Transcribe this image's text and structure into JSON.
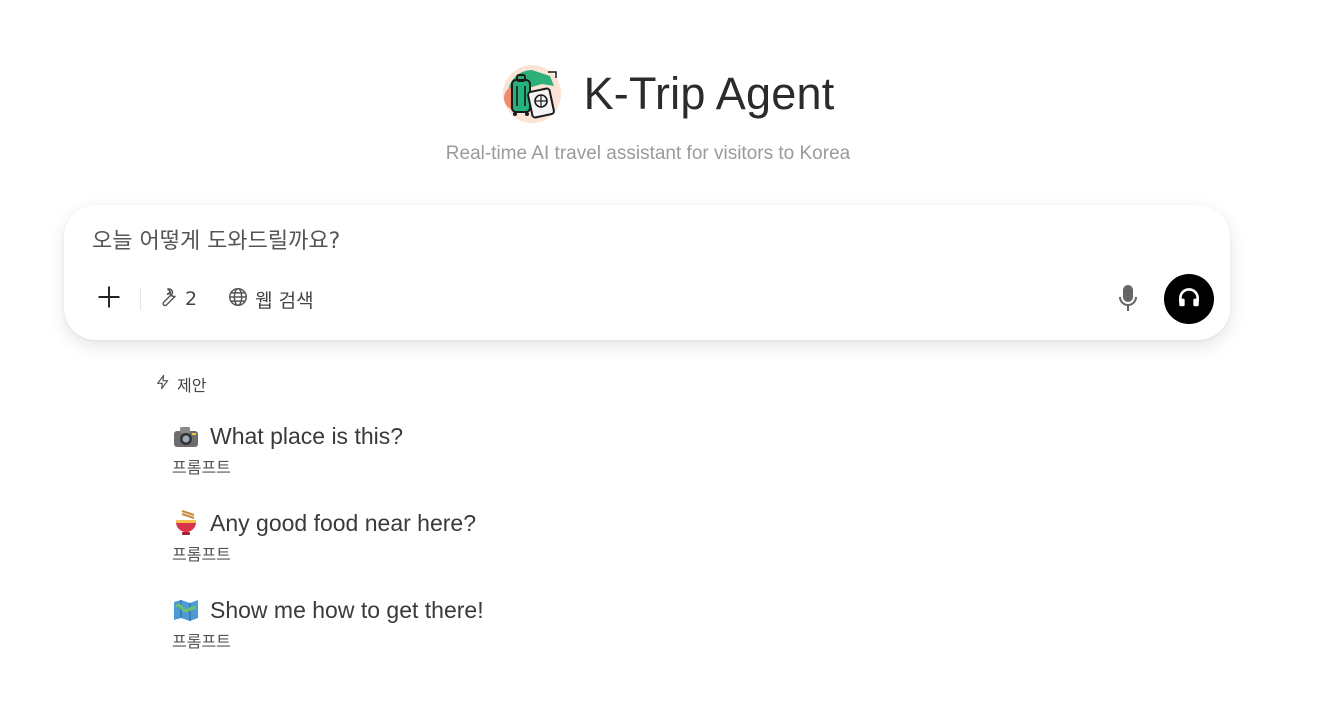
{
  "header": {
    "title": "K-Trip Agent",
    "subtitle": "Real-time AI travel assistant for visitors to Korea",
    "logo_icon": "suitcase-passport-icon"
  },
  "chat": {
    "placeholder": "오늘 어떻게 도와드릴까요?",
    "value": "",
    "toolbar": {
      "add_icon": "plus-icon",
      "tools_icon": "wrench-icon",
      "tools_count": "2",
      "web_search_icon": "globe-icon",
      "web_search_label": "웹 검색",
      "mic_icon": "microphone-icon",
      "voice_icon": "headphones-icon"
    },
    "accent_color": "#000000"
  },
  "suggestions": {
    "header_label": "제안",
    "header_icon": "lightning-icon",
    "items": [
      {
        "emoji": "camera-icon",
        "title": "What place is this?",
        "subtitle": "프롬프트"
      },
      {
        "emoji": "noodle-bowl-icon",
        "title": "Any good food near here?",
        "subtitle": "프롬프트"
      },
      {
        "emoji": "map-icon",
        "title": "Show me how to get there!",
        "subtitle": "프롬프트"
      }
    ]
  }
}
